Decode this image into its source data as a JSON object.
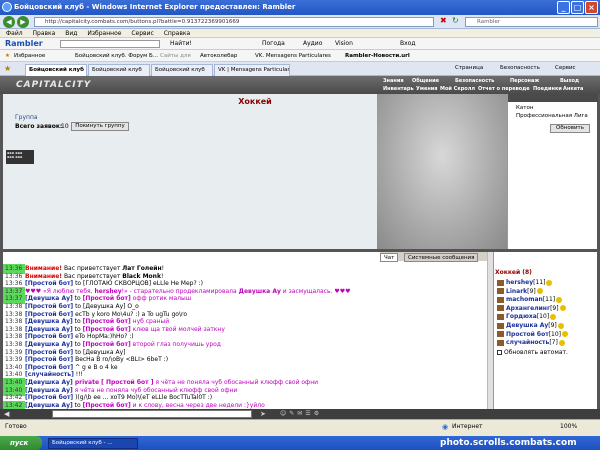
{
  "window": {
    "title": "Бойцовский клуб - Windows Internet Explorer предоставлен: Rambler"
  },
  "address": {
    "url": "http://capitalcity.combats.com/buttons.pl?battle=0.913722369901669",
    "search_placeholder": "Rambler"
  },
  "menu": [
    "Файл",
    "Правка",
    "Вид",
    "Избранное",
    "Сервис",
    "Справка"
  ],
  "rambler_bar": {
    "brand": "Rambler",
    "find": "Найти!",
    "weather": "Погода",
    "audio": "Аудио",
    "vision": "Vision",
    "login": "Вход"
  },
  "favorites_bar": {
    "favorites": "Избранное",
    "items": [
      "Бойцовский клуб. Форум Б...",
      "Сайты для",
      "Автоколебар",
      "VK. Mensagens Particulares",
      "Rambler-Новости.url"
    ]
  },
  "tabs": [
    {
      "label": "Бойцовский клуб",
      "active": true
    },
    {
      "label": "Бойцовский клуб",
      "active": false
    },
    {
      "label": "Бойцовский клуб",
      "active": false
    },
    {
      "label": "VK | Mensagens Particulares",
      "active": false
    }
  ],
  "toolbar_right": {
    "page": "Страница",
    "security": "Безопасность",
    "service": "Сервис"
  },
  "game": {
    "logo": "CAPITALCITY",
    "nav_top": [
      "Знания",
      "Общение",
      "Безопасность",
      "Персонаж",
      "Выход"
    ],
    "nav_bottom": [
      "Инвентарь",
      "Умения",
      "Мой Скролл",
      "Отчет о переводе",
      "Поединки",
      "Анкета"
    ]
  },
  "page": {
    "title": "Хоккей",
    "group_label": "Группа",
    "total_label": "Всего заявок:",
    "total_count": "10",
    "join_button": "Покинуть группу"
  },
  "right_panel": {
    "items": [
      "Катон",
      "Профессиональная Лига"
    ],
    "refresh_button": "Обновить"
  },
  "chat_tabs": [
    {
      "label": "Чат",
      "active": true
    },
    {
      "label": "Системные сообщения",
      "active": false
    }
  ],
  "chat": [
    {
      "time": "13:36",
      "hl": true,
      "parts": [
        {
          "c": "warn",
          "t": "Внимание!"
        },
        {
          "c": "",
          "t": " Вас приветствует "
        },
        {
          "c": "blk-b",
          "t": "Лат Голейн"
        },
        {
          "c": "",
          "t": "!"
        }
      ]
    },
    {
      "time": "13:36",
      "hl": false,
      "parts": [
        {
          "c": "warn",
          "t": "Внимание!"
        },
        {
          "c": "",
          "t": " Вас приветствует "
        },
        {
          "c": "blk-b",
          "t": "Black Monk"
        },
        {
          "c": "",
          "t": "!"
        }
      ]
    },
    {
      "time": "13:36",
      "hl": false,
      "parts": [
        {
          "c": "nick-bot",
          "t": "[Простой бот]"
        },
        {
          "c": "",
          "t": " to [ГЛОТАЮ СКВОРЦОВ] eLLle He Mep? :)"
        }
      ]
    },
    {
      "time": "13:37",
      "hl": true,
      "parts": [
        {
          "c": "mag",
          "t": "♥♥♥ «Я люблю тебя, "
        },
        {
          "c": "mag-b",
          "t": "hershey"
        },
        {
          "c": "mag",
          "t": "!» - старательно продекламировала "
        },
        {
          "c": "mag-b",
          "t": "Девушка Ау"
        },
        {
          "c": "mag",
          "t": " и засмущалась. ♥♥♥"
        }
      ]
    },
    {
      "time": "13:37",
      "hl": true,
      "parts": [
        {
          "c": "nick-dev",
          "t": "[Девушка Ау]"
        },
        {
          "c": "",
          "t": " to "
        },
        {
          "c": "mag-b",
          "t": "[Простой бот]"
        },
        {
          "c": "mag",
          "t": " офф ротик малыш"
        }
      ]
    },
    {
      "time": "13:38",
      "hl": false,
      "parts": [
        {
          "c": "nick-bot",
          "t": "[Простой бот]"
        },
        {
          "c": "",
          "t": " to [Девушка Ау] О_о"
        }
      ]
    },
    {
      "time": "13:38",
      "hl": false,
      "parts": [
        {
          "c": "nick-bot",
          "t": "[Простой бот]"
        },
        {
          "c": "",
          "t": " ecTb y koro Mo\\4u? :) a To ugTu go\\ro"
        }
      ]
    },
    {
      "time": "13:38",
      "hl": false,
      "parts": [
        {
          "c": "nick-dev",
          "t": "[Девушка Ау]"
        },
        {
          "c": "",
          "t": " to "
        },
        {
          "c": "mag-b",
          "t": "[Простой бот]"
        },
        {
          "c": "mag",
          "t": " нуб сраный"
        }
      ]
    },
    {
      "time": "13:38",
      "hl": false,
      "parts": [
        {
          "c": "nick-dev",
          "t": "[Девушка Ау]"
        },
        {
          "c": "",
          "t": " to "
        },
        {
          "c": "mag-b",
          "t": "[Простой бот]"
        },
        {
          "c": "mag",
          "t": " клюв ща твой молчей заткну"
        }
      ]
    },
    {
      "time": "13:38",
      "hl": false,
      "parts": [
        {
          "c": "nick-bot",
          "t": "[Простой бот]"
        },
        {
          "c": "",
          "t": " eTo HopMa:)hHo? :)"
        }
      ]
    },
    {
      "time": "13:38",
      "hl": false,
      "parts": [
        {
          "c": "nick-dev",
          "t": "[Девушка Ау]"
        },
        {
          "c": "",
          "t": " to "
        },
        {
          "c": "mag-b",
          "t": "[Простой бот]"
        },
        {
          "c": "mag",
          "t": " второй глаз получишь урод"
        }
      ]
    },
    {
      "time": "13:39",
      "hl": false,
      "parts": [
        {
          "c": "nick-bot",
          "t": "[Простой бот]"
        },
        {
          "c": "",
          "t": " to [Девушка Ау]"
        }
      ]
    },
    {
      "time": "13:39",
      "hl": false,
      "parts": [
        {
          "c": "nick-bot",
          "t": "[Простой бот]"
        },
        {
          "c": "",
          "t": " BecHa B ro/\\oBy <BLI> 6beT :)"
        }
      ]
    },
    {
      "time": "13:40",
      "hl": false,
      "parts": [
        {
          "c": "nick-bot",
          "t": "[Простой бот]"
        },
        {
          "c": "",
          "t": " ^ g e B o 4 ke"
        }
      ]
    },
    {
      "time": "13:40",
      "hl": false,
      "parts": [
        {
          "c": "nick-bot",
          "t": "[случайность]"
        },
        {
          "c": "",
          "t": " !!!"
        }
      ]
    },
    {
      "time": "13:40",
      "hl": true,
      "parts": [
        {
          "c": "nick-dev",
          "t": "[Девушка Ау]"
        },
        {
          "c": "mag-b",
          "t": " private [ Простой бот ]"
        },
        {
          "c": "mag",
          "t": " я чёта не поняла чуб обосанный клюфф свой офни"
        }
      ]
    },
    {
      "time": "13:40",
      "hl": true,
      "parts": [
        {
          "c": "nick-dev",
          "t": "[Девушка Ау]"
        },
        {
          "c": "mag",
          "t": " я чёта не поняла чуб обосанный клюфф свой офни"
        }
      ]
    },
    {
      "time": "13:42",
      "hl": false,
      "parts": [
        {
          "c": "nick-bot",
          "t": "[Простой бот]"
        },
        {
          "c": "",
          "t": " )(g/\\b ee ... xoT9 Mo)\\(eT eLLle BocTTuTal0T :)"
        }
      ]
    },
    {
      "time": "13:42",
      "hl": true,
      "parts": [
        {
          "c": "nick-dev",
          "t": "[Девушка Ау]"
        },
        {
          "c": "",
          "t": " to "
        },
        {
          "c": "mag-b",
          "t": "[Простой бот]"
        },
        {
          "c": "mag",
          "t": " и к слову, весна через две недели :}уйло"
        }
      ]
    }
  ],
  "userlist": {
    "title": "Хоккей (8)",
    "users": [
      {
        "name": "hershey",
        "level": "[11]"
      },
      {
        "name": "Linark",
        "level": "[9]"
      },
      {
        "name": "machoman",
        "level": "[11]"
      },
      {
        "name": "Архангелинг",
        "level": "[9]"
      },
      {
        "name": "Гордюха",
        "level": "[10]"
      },
      {
        "name": "Девушка Ау",
        "level": "[9]"
      },
      {
        "name": "Простой бот",
        "level": "[10]"
      },
      {
        "name": "случайность",
        "level": "[7]"
      }
    ],
    "auto_update": "Обновлять автомат."
  },
  "statusbar": {
    "left": "Готово",
    "zone": "Интернет",
    "zoom": "100%"
  },
  "taskbar": {
    "start": "пуск",
    "item": "Бойцовский клуб - ...",
    "watermark": "photo.scrolls.combats.com"
  },
  "colors": {
    "accent": "#8b0000",
    "nick": "#1a2f9a",
    "private": "#c000c0",
    "highlight": "#5cd85c"
  }
}
